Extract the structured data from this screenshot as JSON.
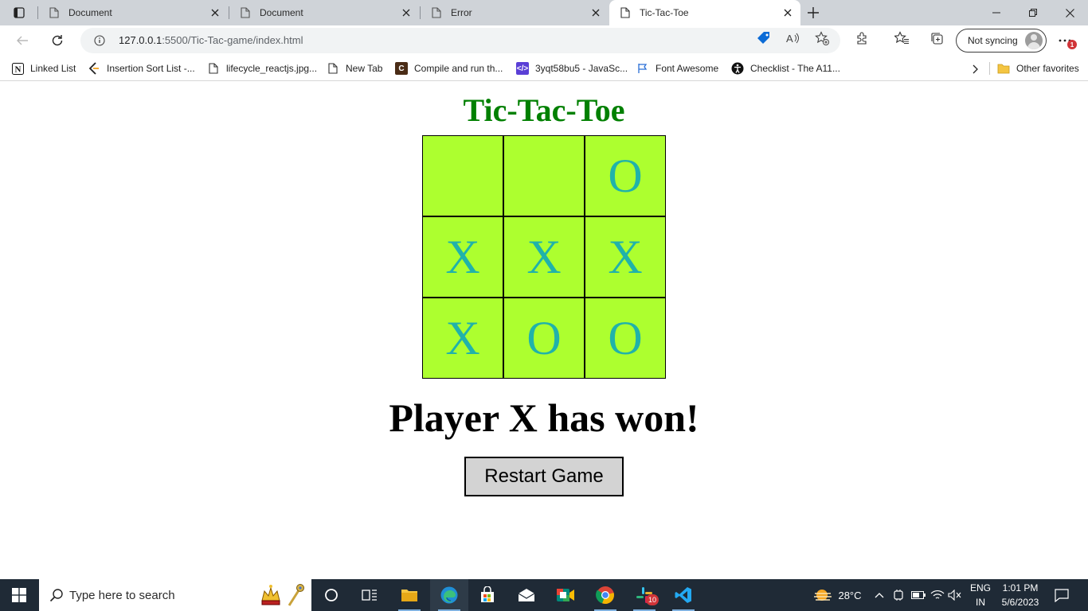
{
  "browser": {
    "tabs": [
      {
        "title": "Document",
        "active": false
      },
      {
        "title": "Document",
        "active": false
      },
      {
        "title": "Error",
        "active": false
      },
      {
        "title": "Tic-Tac-Toe",
        "active": true
      }
    ],
    "url": {
      "host": "127.0.0.1",
      "path": ":5500/Tic-Tac-game/index.html"
    },
    "sync_label": "Not syncing",
    "notification_count": "1",
    "bookmarks": [
      {
        "label": "Linked List",
        "icon": "notion-icon"
      },
      {
        "label": "Insertion Sort List -...",
        "icon": "leetcode-icon"
      },
      {
        "label": "lifecycle_reactjs.jpg...",
        "icon": "file-icon"
      },
      {
        "label": "New Tab",
        "icon": "file-icon"
      },
      {
        "label": "Compile and run th...",
        "icon": "compiler-icon"
      },
      {
        "label": "3yqt58bu5 - JavaSc...",
        "icon": "code-icon"
      },
      {
        "label": "Font Awesome",
        "icon": "flag-icon"
      },
      {
        "label": "Checklist - The A11...",
        "icon": "accessibility-icon"
      }
    ],
    "other_favorites": "Other favorites"
  },
  "game": {
    "title": "Tic-Tac-Toe",
    "board": [
      "",
      "",
      "O",
      "X",
      "X",
      "X",
      "X",
      "O",
      "O"
    ],
    "status": "Player X has won!",
    "restart_label": "Restart Game",
    "colors": {
      "title": "#008000",
      "cell_bg": "#adff2f",
      "mark": "#20b2aa",
      "button_bg": "#d3d3d3"
    }
  },
  "taskbar": {
    "search_placeholder": "Type here to search",
    "temperature": "28°C",
    "language": "ENG",
    "region": "IN",
    "time": "1:01 PM",
    "date": "5/6/2023",
    "slack_badge": "10"
  }
}
